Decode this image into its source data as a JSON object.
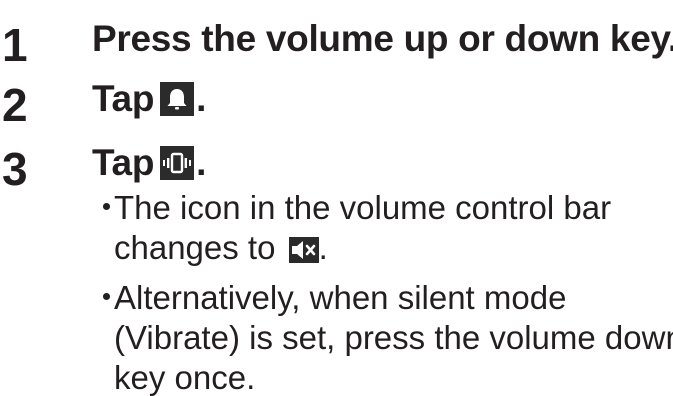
{
  "steps": [
    {
      "number": "1",
      "text": "Press the volume up or down key."
    },
    {
      "number": "2",
      "text_before": "Tap ",
      "icon": "bell-icon",
      "text_after": "."
    },
    {
      "number": "3",
      "text_before": "Tap ",
      "icon": "vibrate-icon",
      "text_after": "."
    }
  ],
  "bullets": [
    {
      "symbol": "・",
      "lines": [
        "The icon in the volume control bar",
        "changes to "
      ],
      "icon": "mute-speaker-icon",
      "tail": "."
    },
    {
      "symbol": "・",
      "lines": [
        "Alternatively, when silent mode",
        "(Vibrate) is set, press the volume down",
        "key once."
      ]
    }
  ]
}
